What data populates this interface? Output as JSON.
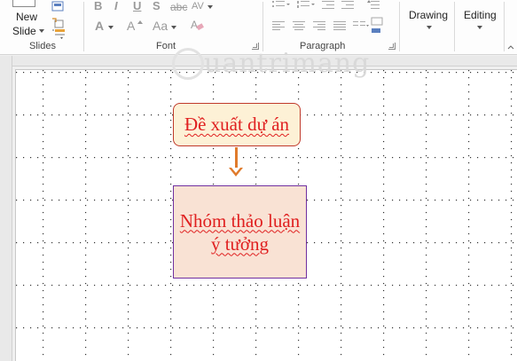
{
  "ribbon": {
    "slides_group": {
      "new_label": "New",
      "slide_label": "Slide",
      "group_label": "Slides"
    },
    "font_group": {
      "bold": "B",
      "italic": "I",
      "underline": "U",
      "shadow": "S",
      "strikethrough": "abc",
      "spacing": "AV",
      "font_color": "A",
      "size_up": "A",
      "case": "Aa",
      "group_label": "Font"
    },
    "paragraph_group": {
      "group_label": "Paragraph"
    },
    "drawing": {
      "label": "Drawing"
    },
    "editing": {
      "label": "Editing"
    }
  },
  "slide": {
    "watermark": "uantrimang",
    "shape_top": {
      "text": "Đề xuất dự án"
    },
    "shape_bottom": {
      "line1": "Nhóm thảo luận",
      "line2": "ý tưởng"
    }
  },
  "colors": {
    "shape_text": "#e02020",
    "shape_top_fill": "#fdf1d6",
    "shape_top_border": "#c0392b",
    "shape_bottom_fill": "#f9e2d4",
    "shape_bottom_border": "#7030a0",
    "arrow": "#e07b2c"
  }
}
